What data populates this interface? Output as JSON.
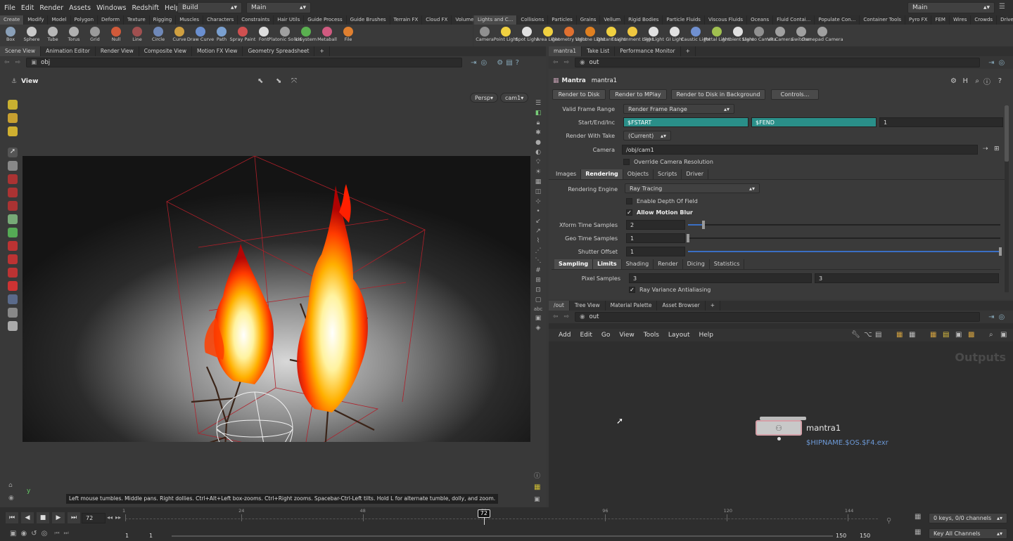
{
  "menu": [
    "File",
    "Edit",
    "Render",
    "Assets",
    "Windows",
    "Redshift",
    "Help"
  ],
  "desktop": {
    "build": "Build",
    "main": "Main",
    "right_main": "Main"
  },
  "shelf_left": {
    "tabs": [
      "Create",
      "Modify",
      "Model",
      "Polygon",
      "Deform",
      "Texture",
      "Rigging",
      "Muscles",
      "Characters",
      "Constraints",
      "Hair Utils",
      "Guide Process",
      "Guide Brushes",
      "Terrain FX",
      "Cloud FX",
      "Volume"
    ],
    "tools": [
      {
        "label": "Box",
        "icon": "box-icon",
        "color": "#8aa0b8"
      },
      {
        "label": "Sphere",
        "icon": "sphere-icon",
        "color": "#c9c9c9"
      },
      {
        "label": "Tube",
        "icon": "tube-icon",
        "color": "#b8b8b8"
      },
      {
        "label": "Torus",
        "icon": "torus-icon",
        "color": "#b0b0b0"
      },
      {
        "label": "Grid",
        "icon": "grid-icon",
        "color": "#9a9a9a"
      },
      {
        "label": "Null",
        "icon": "null-icon",
        "color": "#d05a3a"
      },
      {
        "label": "Line",
        "icon": "line-icon",
        "color": "#a05050"
      },
      {
        "label": "Circle",
        "icon": "circle-icon",
        "color": "#6f88b8"
      },
      {
        "label": "Curve",
        "icon": "curve-icon",
        "color": "#d0a040"
      },
      {
        "label": "Draw Curve",
        "icon": "draw-curve-icon",
        "color": "#6a8fd0"
      },
      {
        "label": "Path",
        "icon": "path-icon",
        "color": "#7aa0d0"
      },
      {
        "label": "Spray Paint",
        "icon": "spray-paint-icon",
        "color": "#d05050"
      },
      {
        "label": "Font",
        "icon": "font-icon",
        "color": "#dddddd"
      },
      {
        "label": "Platonic Solids",
        "icon": "platonic-icon",
        "color": "#a0a0a0"
      },
      {
        "label": "L-System",
        "icon": "lsystem-icon",
        "color": "#5ab050"
      },
      {
        "label": "Metaball",
        "icon": "metaball-icon",
        "color": "#d05a80"
      },
      {
        "label": "File",
        "icon": "file-icon",
        "color": "#e08030"
      }
    ]
  },
  "shelf_right": {
    "tabs": [
      "Lights and C...",
      "Collisions",
      "Particles",
      "Grains",
      "Vellum",
      "Rigid Bodies",
      "Particle Fluids",
      "Viscous Fluids",
      "Oceans",
      "Fluid Contai...",
      "Populate Con...",
      "Container Tools",
      "Pyro FX",
      "FEM",
      "Wires",
      "Crowds",
      "Drive Simula..."
    ],
    "tools": [
      {
        "label": "Camera",
        "icon": "camera-icon",
        "color": "#909090"
      },
      {
        "label": "Point Light",
        "icon": "point-light-icon",
        "color": "#f0d040"
      },
      {
        "label": "Spot Light",
        "icon": "spot-light-icon",
        "color": "#e0e0e0"
      },
      {
        "label": "Area Light",
        "icon": "area-light-icon",
        "color": "#f0d040"
      },
      {
        "label": "Geometry Light",
        "icon": "geometry-light-icon",
        "color": "#e07030"
      },
      {
        "label": "Volume Light",
        "icon": "volume-light-icon",
        "color": "#e08020"
      },
      {
        "label": "Distant Light",
        "icon": "distant-light-icon",
        "color": "#f0d040"
      },
      {
        "label": "Environment Light",
        "icon": "environment-light-icon",
        "color": "#f0c840"
      },
      {
        "label": "Sky Light",
        "icon": "sky-light-icon",
        "color": "#e0e0e0"
      },
      {
        "label": "GI Light",
        "icon": "gi-light-icon",
        "color": "#e0e0e0"
      },
      {
        "label": "Caustic Light",
        "icon": "caustic-light-icon",
        "color": "#7090d0"
      },
      {
        "label": "Portal Light",
        "icon": "portal-light-icon",
        "color": "#a0c050"
      },
      {
        "label": "Ambient Light",
        "icon": "ambient-light-icon",
        "color": "#e0e0e0"
      },
      {
        "label": "Stereo Camera",
        "icon": "stereo-camera-icon",
        "color": "#909090"
      },
      {
        "label": "VR Camera",
        "icon": "vr-camera-icon",
        "color": "#a0a0a0"
      },
      {
        "label": "Switcher",
        "icon": "switcher-icon",
        "color": "#a0a0a0"
      },
      {
        "label": "Gamepad Camera",
        "icon": "gamepad-camera-icon",
        "color": "#a0a0a0"
      }
    ]
  },
  "left_pane": {
    "tabs": [
      "Scene View",
      "Animation Editor",
      "Render View",
      "Composite View",
      "Motion FX View",
      "Geometry Spreadsheet"
    ],
    "path": "obj",
    "view_label": "View",
    "persp": "Persp",
    "cam": "cam1",
    "status": "Left mouse tumbles. Middle pans. Right dollies. Ctrl+Alt+Left box-zooms. Ctrl+Right zooms. Spacebar-Ctrl-Left tilts. Hold L for alternate tumble, dolly, and zoom.",
    "axis_y": "y"
  },
  "params": {
    "tabs": [
      "mantra1",
      "Take List",
      "Performance Monitor"
    ],
    "path": "out",
    "node_type": "Mantra",
    "node_name": "mantra1",
    "buttons": [
      "Render to Disk",
      "Render to MPlay",
      "Render to Disk in Background",
      "Controls..."
    ],
    "valid_frame_range_label": "Valid Frame Range",
    "valid_frame_range": "Render Frame Range",
    "start_end_label": "Start/End/Inc",
    "start": "$FSTART",
    "end": "$FEND",
    "inc": "1",
    "render_take_label": "Render With Take",
    "render_take": "(Current)",
    "camera_label": "Camera",
    "camera": "/obj/cam1",
    "override_label": "Override Camera Resolution",
    "main_tabs": [
      "Images",
      "Rendering",
      "Objects",
      "Scripts",
      "Driver"
    ],
    "engine_label": "Rendering Engine",
    "engine": "Ray Tracing",
    "dof_label": "Enable Depth Of Field",
    "mblur_label": "Allow Motion Blur",
    "xform_label": "Xform Time Samples",
    "xform": "2",
    "xform_frac": 0.05,
    "geo_label": "Geo Time Samples",
    "geo": "1",
    "geo_frac": 0.0,
    "shutter_label": "Shutter Offset",
    "shutter": "1",
    "shutter_frac": 1.0,
    "sub_tabs": [
      "Sampling",
      "Limits",
      "Shading",
      "Render",
      "Dicing",
      "Statistics"
    ],
    "pixel_label": "Pixel Samples",
    "pixel_x": "3",
    "pixel_y": "3",
    "variance_label": "Ray Variance Antialiasing"
  },
  "network": {
    "tabs": [
      "/out",
      "Tree View",
      "Material Palette",
      "Asset Browser"
    ],
    "path": "out",
    "menu": [
      "Add",
      "Edit",
      "Go",
      "View",
      "Tools",
      "Layout",
      "Help"
    ],
    "context": "Outputs",
    "node_name": "mantra1",
    "node_output": "$HIPNAME.$OS.$F4.exr"
  },
  "timeline": {
    "frame": "72",
    "ticks": [
      "1",
      "24",
      "48",
      "72",
      "96",
      "120",
      "144"
    ],
    "current": 72,
    "start": 1,
    "end": 150,
    "start_a": "1",
    "start_b": "1",
    "end_a": "150",
    "end_b": "150",
    "keys": "0 keys, 0/0 channels",
    "channels": "Key All Channels"
  }
}
